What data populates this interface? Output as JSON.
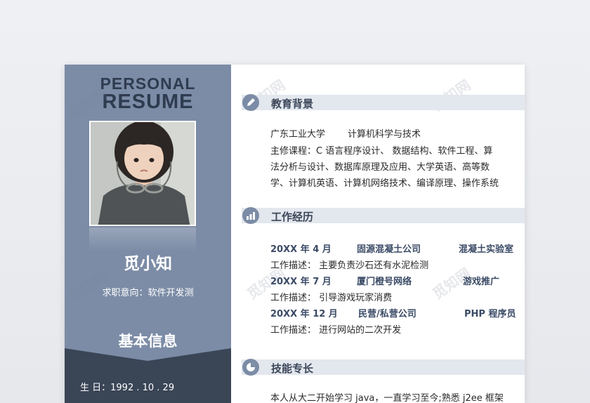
{
  "sidebar": {
    "title_top": "PERSONAL",
    "title_bottom": "RESUME",
    "name": "觅小知",
    "intent": "求职意向：软件开发测",
    "basic_info_heading": "基本信息",
    "birth": "生 日：1992 . 10 . 29"
  },
  "watermark": "觅知网",
  "colors": {
    "sidebar": "#7c8ca6",
    "dark": "#3a4556",
    "section_bar": "#e3e7ee",
    "job_text": "#3b4b66"
  },
  "education": {
    "heading": "教育背景",
    "icon": "pencil-icon",
    "school": "广东工业大学",
    "major": "计算机科学与技术",
    "courses_1": "主修课程：C 语言程序设计、 数据结构、软件工程、算",
    "courses_2": "法分析与设计、数据库原理及应用、大学英语、高等数",
    "courses_3": "学、计算机英语、计算机网络技术、编译原理、操作系统"
  },
  "work": {
    "heading": "工作经历",
    "icon": "bar-chart-icon",
    "jobs": [
      {
        "date": "20XX 年 4 月",
        "company": "固源混凝土公司",
        "role": "混凝土实验室",
        "desc": "工作描述：  主要负责沙石还有水泥检测"
      },
      {
        "date": "20XX 年 7 月",
        "company": "厦门橙号网络",
        "role": "游戏推广",
        "desc": "工作描述：  引导游戏玩家消费"
      },
      {
        "date": "20XX 年 12 月",
        "company": "民营/私营公司",
        "role": "PHP 程序员",
        "desc": "工作描述：  进行网站的二次开发"
      }
    ]
  },
  "skills": {
    "heading": "技能专长",
    "icon": "pie-chart-icon",
    "line_1": "本人从大二开始学习 java，一直学习至今;熟悉 j2ee 框架"
  }
}
